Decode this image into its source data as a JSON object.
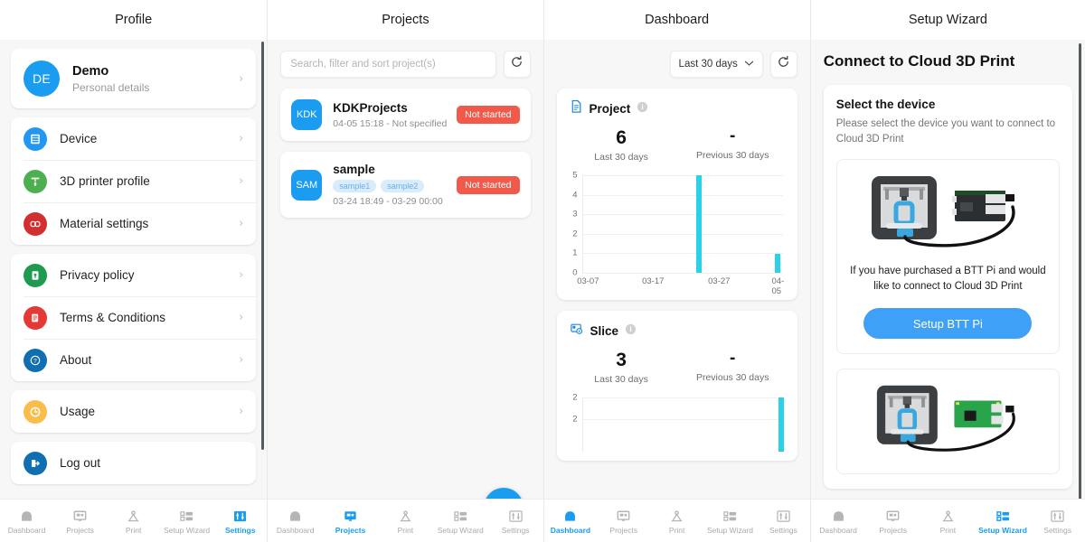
{
  "panels": [
    {
      "title": "Profile"
    },
    {
      "title": "Projects"
    },
    {
      "title": "Dashboard"
    },
    {
      "title": "Setup Wizard"
    }
  ],
  "profile": {
    "user": {
      "initials": "DE",
      "name": "Demo",
      "subtitle": "Personal details",
      "chevron": "›"
    },
    "groups": [
      {
        "items": [
          {
            "label": "Device",
            "icon": "device-icon",
            "color": "#2196f3"
          },
          {
            "label": "3D printer profile",
            "icon": "printer-profile-icon",
            "color": "#4caf50"
          },
          {
            "label": "Material settings",
            "icon": "material-settings-icon",
            "color": "#d32f2f"
          }
        ]
      },
      {
        "items": [
          {
            "label": "Privacy policy",
            "icon": "privacy-icon",
            "color": "#1e9b4e"
          },
          {
            "label": "Terms & Conditions",
            "icon": "terms-icon",
            "color": "#e53935"
          },
          {
            "label": "About",
            "icon": "about-icon",
            "color": "#0f6fb0"
          }
        ]
      },
      {
        "items": [
          {
            "label": "Usage",
            "icon": "usage-clock-icon",
            "color": "#f9bd4a"
          }
        ]
      },
      {
        "items": [
          {
            "label": "Log out",
            "icon": "logout-icon",
            "color": "#0f6fb0"
          }
        ]
      }
    ]
  },
  "projects": {
    "search_placeholder": "Search, filter and sort project(s)",
    "search_value": "",
    "refresh_icon": "refresh-icon",
    "add_label": "+",
    "items": [
      {
        "badge": "KDK",
        "name": "KDKProjects",
        "date": "04-05 15:18 - Not specified",
        "tags": [],
        "status": "Not started"
      },
      {
        "badge": "SAM",
        "name": "sample",
        "date": "03-24 18:49 - 03-29 00:00",
        "tags": [
          "sample1",
          "sample2"
        ],
        "status": "Not started"
      }
    ]
  },
  "dashboard": {
    "range_label": "Last 30 days",
    "range_caret": "∨",
    "refresh_icon": "refresh-icon",
    "cards": [
      {
        "title": "Project",
        "icon": "document-icon",
        "info_icon": "info-icon",
        "stats": [
          {
            "value": "6",
            "label": "Last 30 days"
          },
          {
            "value": "-",
            "label": "Previous 30 days"
          }
        ]
      },
      {
        "title": "Slice",
        "icon": "slice-icon",
        "info_icon": "info-icon",
        "stats": [
          {
            "value": "3",
            "label": "Last 30 days"
          },
          {
            "value": "-",
            "label": "Previous 30 days"
          }
        ]
      }
    ]
  },
  "chart_data": [
    {
      "type": "bar",
      "title": "Project",
      "xlabel": "",
      "ylabel": "",
      "x": [
        "03-07",
        "03-17",
        "03-27",
        "04-05"
      ],
      "tick_positions": [
        0,
        0.335,
        0.665,
        0.965
      ],
      "yticks": [
        "0",
        "1",
        "2",
        "3",
        "4",
        "5"
      ],
      "ylim": [
        0,
        5
      ],
      "grid": true,
      "bars": [
        {
          "x": "03-23",
          "position": 0.552,
          "value": 5
        },
        {
          "x": "04-04",
          "position": 0.935,
          "value": 1
        }
      ],
      "color": "#2ad2e8"
    },
    {
      "type": "bar",
      "title": "Slice",
      "xlabel": "",
      "ylabel": "",
      "x": [],
      "tick_positions": [],
      "yticks": [
        "2",
        "2"
      ],
      "ylim": [
        0,
        2
      ],
      "grid": true,
      "bars": [
        {
          "x": "",
          "position": 0.955,
          "value": 2
        }
      ],
      "color": "#2ad2e8"
    }
  ],
  "wizard": {
    "heading": "Connect to Cloud 3D Print",
    "section_title": "Select the device",
    "section_desc": "Please select the device you want to connect to Cloud 3D Print",
    "devices": [
      {
        "image": "printer-and-btt-pi-illustration",
        "caption": "If you have purchased a BTT Pi and would like to connect to Cloud 3D Print",
        "button": "Setup BTT Pi"
      },
      {
        "image": "printer-and-raspberry-pi-illustration",
        "caption": "",
        "button": ""
      }
    ]
  },
  "bottom_nav": {
    "items": [
      {
        "label": "Dashboard",
        "icon": "home-icon"
      },
      {
        "label": "Projects",
        "icon": "monitor-icon"
      },
      {
        "label": "Print",
        "icon": "print-nozzle-icon"
      },
      {
        "label": "Setup Wizard",
        "icon": "checklist-icon"
      },
      {
        "label": "Settings",
        "icon": "sliders-icon"
      }
    ],
    "active_per_panel": [
      4,
      1,
      0,
      3
    ],
    "active_color": "#1a9cf0",
    "inactive_color": "#b5b5b5"
  }
}
